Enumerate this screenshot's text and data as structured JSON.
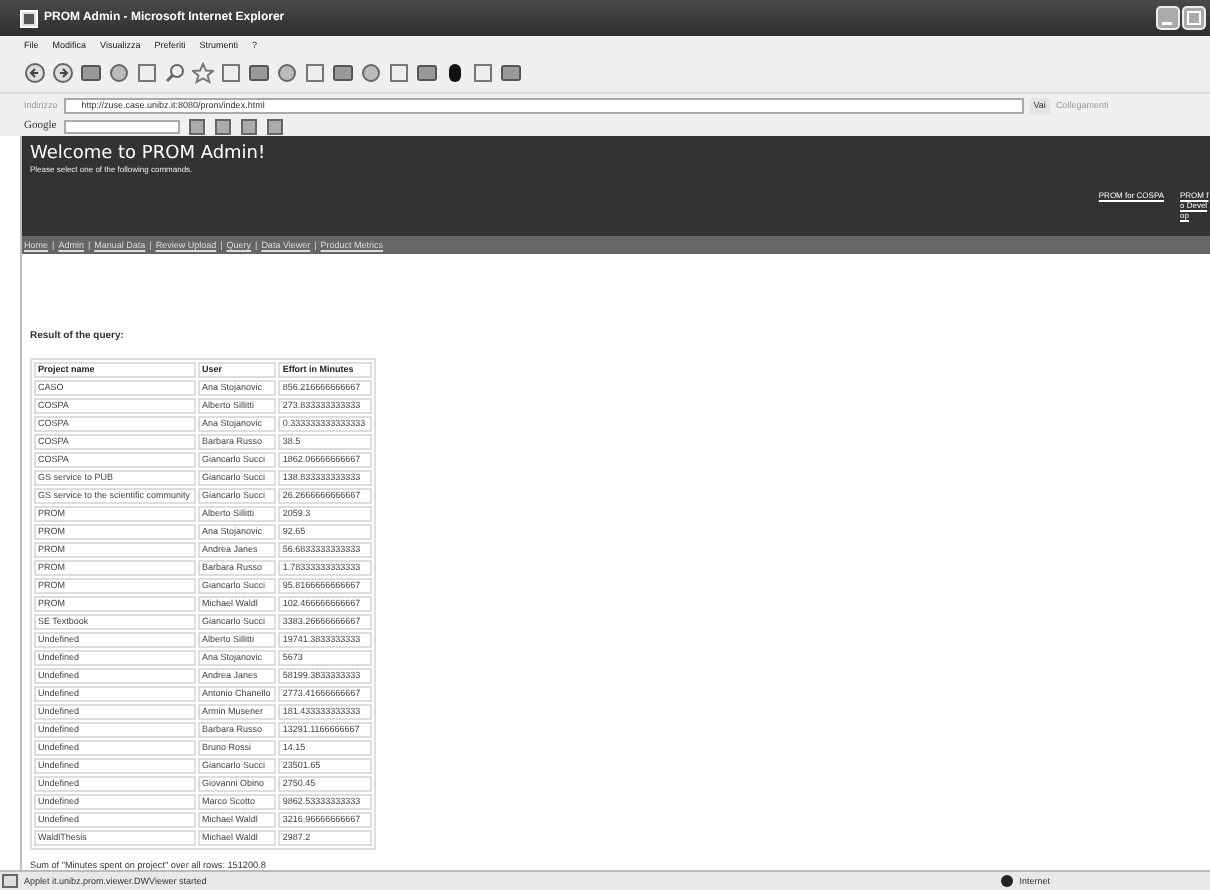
{
  "window": {
    "title": "PROM Admin - Microsoft Internet Explorer"
  },
  "menu_bar": [
    "File",
    "Modifica",
    "Visualizza",
    "Preferiti",
    "Strumenti",
    "?"
  ],
  "address_bar": {
    "label": "Indirizzo",
    "url": "http://zuse.case.unibz.it:8080/prom/index.html",
    "go": "Vai",
    "links": "Collegamenti"
  },
  "google_bar": {
    "label": "Google"
  },
  "header": {
    "title": "Welcome to PROM Admin!",
    "subtitle": "Please select one of the following commands.",
    "links": [
      "PROM for COSPA",
      "PROM fo Develop"
    ]
  },
  "nav": {
    "separator": "|",
    "items": [
      "Home",
      "Admin",
      "Manual Data",
      "Review Upload",
      "Query",
      "Data Viewer",
      "Product Metrics"
    ]
  },
  "content": {
    "heading": "Result of the query:",
    "table": {
      "columns": [
        "Project name",
        "User",
        "Effort in Minutes"
      ],
      "rows": [
        [
          "CASO",
          "Ana Stojanovic",
          "856.216666666667"
        ],
        [
          "COSPA",
          "Alberto Sillitti",
          "273.833333333333"
        ],
        [
          "COSPA",
          "Ana Stojanovic",
          "0.333333333333333"
        ],
        [
          "COSPA",
          "Barbara Russo",
          "38.5"
        ],
        [
          "COSPA",
          "Giancarlo Succi",
          "1862.06666666667"
        ],
        [
          "GS service to PUB",
          "Giancarlo Succi",
          "138.833333333333"
        ],
        [
          "GS service to the scientific community",
          "Giancarlo Succi",
          "26.2666666666667"
        ],
        [
          "PROM",
          "Alberto Sillitti",
          "2059.3"
        ],
        [
          "PROM",
          "Ana Stojanovic",
          "92.65"
        ],
        [
          "PROM",
          "Andrea Janes",
          "56.6833333333333"
        ],
        [
          "PROM",
          "Barbara Russo",
          "1.78333333333333"
        ],
        [
          "PROM",
          "Giancarlo Succi",
          "95.8166666666667"
        ],
        [
          "PROM",
          "Michael Waldl",
          "102.466666666667"
        ],
        [
          "SE Textbook",
          "Giancarlo Succi",
          "3383.26666666667"
        ],
        [
          "Undefined",
          "Alberto Sillitti",
          "19741.3833333333"
        ],
        [
          "Undefined",
          "Ana Stojanovic",
          "5673"
        ],
        [
          "Undefined",
          "Andrea Janes",
          "58199.3833333333"
        ],
        [
          "Undefined",
          "Antonio Chanello",
          "2773.41666666667"
        ],
        [
          "Undefined",
          "Armin Musener",
          "181.433333333333"
        ],
        [
          "Undefined",
          "Barbara Russo",
          "13291.1166666667"
        ],
        [
          "Undefined",
          "Bruno Rossi",
          "14.15"
        ],
        [
          "Undefined",
          "Giancarlo Succi",
          "23501.65"
        ],
        [
          "Undefined",
          "Giovanni Obino",
          "2750.45"
        ],
        [
          "Undefined",
          "Marco Scotto",
          "9862.53333333333"
        ],
        [
          "Undefined",
          "Michael Waldl",
          "3216.96666666667"
        ],
        [
          "WaldlThesis",
          "Michael Waldl",
          "2987.2"
        ]
      ]
    },
    "sum": "Sum of \"Minutes spent on project\" over all rows: 151200.8"
  },
  "status_bar": {
    "text": "Applet it.unibz.prom.viewer.DWViewer started",
    "zone": "Internet"
  }
}
